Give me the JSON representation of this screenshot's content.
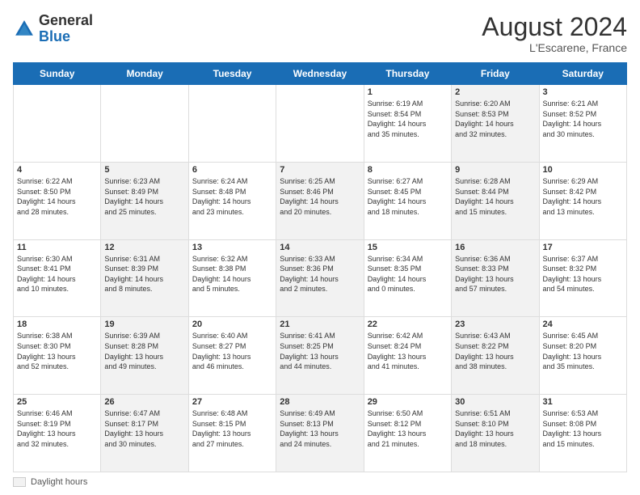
{
  "logo": {
    "text_general": "General",
    "text_blue": "Blue"
  },
  "header": {
    "month_year": "August 2024",
    "location": "L'Escarene, France"
  },
  "weekdays": [
    "Sunday",
    "Monday",
    "Tuesday",
    "Wednesday",
    "Thursday",
    "Friday",
    "Saturday"
  ],
  "weeks": [
    [
      {
        "day": "",
        "info": "",
        "shaded": false
      },
      {
        "day": "",
        "info": "",
        "shaded": false
      },
      {
        "day": "",
        "info": "",
        "shaded": false
      },
      {
        "day": "",
        "info": "",
        "shaded": false
      },
      {
        "day": "1",
        "info": "Sunrise: 6:19 AM\nSunset: 8:54 PM\nDaylight: 14 hours\nand 35 minutes.",
        "shaded": false
      },
      {
        "day": "2",
        "info": "Sunrise: 6:20 AM\nSunset: 8:53 PM\nDaylight: 14 hours\nand 32 minutes.",
        "shaded": true
      },
      {
        "day": "3",
        "info": "Sunrise: 6:21 AM\nSunset: 8:52 PM\nDaylight: 14 hours\nand 30 minutes.",
        "shaded": false
      }
    ],
    [
      {
        "day": "4",
        "info": "Sunrise: 6:22 AM\nSunset: 8:50 PM\nDaylight: 14 hours\nand 28 minutes.",
        "shaded": false
      },
      {
        "day": "5",
        "info": "Sunrise: 6:23 AM\nSunset: 8:49 PM\nDaylight: 14 hours\nand 25 minutes.",
        "shaded": true
      },
      {
        "day": "6",
        "info": "Sunrise: 6:24 AM\nSunset: 8:48 PM\nDaylight: 14 hours\nand 23 minutes.",
        "shaded": false
      },
      {
        "day": "7",
        "info": "Sunrise: 6:25 AM\nSunset: 8:46 PM\nDaylight: 14 hours\nand 20 minutes.",
        "shaded": true
      },
      {
        "day": "8",
        "info": "Sunrise: 6:27 AM\nSunset: 8:45 PM\nDaylight: 14 hours\nand 18 minutes.",
        "shaded": false
      },
      {
        "day": "9",
        "info": "Sunrise: 6:28 AM\nSunset: 8:44 PM\nDaylight: 14 hours\nand 15 minutes.",
        "shaded": true
      },
      {
        "day": "10",
        "info": "Sunrise: 6:29 AM\nSunset: 8:42 PM\nDaylight: 14 hours\nand 13 minutes.",
        "shaded": false
      }
    ],
    [
      {
        "day": "11",
        "info": "Sunrise: 6:30 AM\nSunset: 8:41 PM\nDaylight: 14 hours\nand 10 minutes.",
        "shaded": false
      },
      {
        "day": "12",
        "info": "Sunrise: 6:31 AM\nSunset: 8:39 PM\nDaylight: 14 hours\nand 8 minutes.",
        "shaded": true
      },
      {
        "day": "13",
        "info": "Sunrise: 6:32 AM\nSunset: 8:38 PM\nDaylight: 14 hours\nand 5 minutes.",
        "shaded": false
      },
      {
        "day": "14",
        "info": "Sunrise: 6:33 AM\nSunset: 8:36 PM\nDaylight: 14 hours\nand 2 minutes.",
        "shaded": true
      },
      {
        "day": "15",
        "info": "Sunrise: 6:34 AM\nSunset: 8:35 PM\nDaylight: 14 hours\nand 0 minutes.",
        "shaded": false
      },
      {
        "day": "16",
        "info": "Sunrise: 6:36 AM\nSunset: 8:33 PM\nDaylight: 13 hours\nand 57 minutes.",
        "shaded": true
      },
      {
        "day": "17",
        "info": "Sunrise: 6:37 AM\nSunset: 8:32 PM\nDaylight: 13 hours\nand 54 minutes.",
        "shaded": false
      }
    ],
    [
      {
        "day": "18",
        "info": "Sunrise: 6:38 AM\nSunset: 8:30 PM\nDaylight: 13 hours\nand 52 minutes.",
        "shaded": false
      },
      {
        "day": "19",
        "info": "Sunrise: 6:39 AM\nSunset: 8:28 PM\nDaylight: 13 hours\nand 49 minutes.",
        "shaded": true
      },
      {
        "day": "20",
        "info": "Sunrise: 6:40 AM\nSunset: 8:27 PM\nDaylight: 13 hours\nand 46 minutes.",
        "shaded": false
      },
      {
        "day": "21",
        "info": "Sunrise: 6:41 AM\nSunset: 8:25 PM\nDaylight: 13 hours\nand 44 minutes.",
        "shaded": true
      },
      {
        "day": "22",
        "info": "Sunrise: 6:42 AM\nSunset: 8:24 PM\nDaylight: 13 hours\nand 41 minutes.",
        "shaded": false
      },
      {
        "day": "23",
        "info": "Sunrise: 6:43 AM\nSunset: 8:22 PM\nDaylight: 13 hours\nand 38 minutes.",
        "shaded": true
      },
      {
        "day": "24",
        "info": "Sunrise: 6:45 AM\nSunset: 8:20 PM\nDaylight: 13 hours\nand 35 minutes.",
        "shaded": false
      }
    ],
    [
      {
        "day": "25",
        "info": "Sunrise: 6:46 AM\nSunset: 8:19 PM\nDaylight: 13 hours\nand 32 minutes.",
        "shaded": false
      },
      {
        "day": "26",
        "info": "Sunrise: 6:47 AM\nSunset: 8:17 PM\nDaylight: 13 hours\nand 30 minutes.",
        "shaded": true
      },
      {
        "day": "27",
        "info": "Sunrise: 6:48 AM\nSunset: 8:15 PM\nDaylight: 13 hours\nand 27 minutes.",
        "shaded": false
      },
      {
        "day": "28",
        "info": "Sunrise: 6:49 AM\nSunset: 8:13 PM\nDaylight: 13 hours\nand 24 minutes.",
        "shaded": true
      },
      {
        "day": "29",
        "info": "Sunrise: 6:50 AM\nSunset: 8:12 PM\nDaylight: 13 hours\nand 21 minutes.",
        "shaded": false
      },
      {
        "day": "30",
        "info": "Sunrise: 6:51 AM\nSunset: 8:10 PM\nDaylight: 13 hours\nand 18 minutes.",
        "shaded": true
      },
      {
        "day": "31",
        "info": "Sunrise: 6:53 AM\nSunset: 8:08 PM\nDaylight: 13 hours\nand 15 minutes.",
        "shaded": false
      }
    ]
  ],
  "footer": {
    "legend_label": "Daylight hours"
  }
}
